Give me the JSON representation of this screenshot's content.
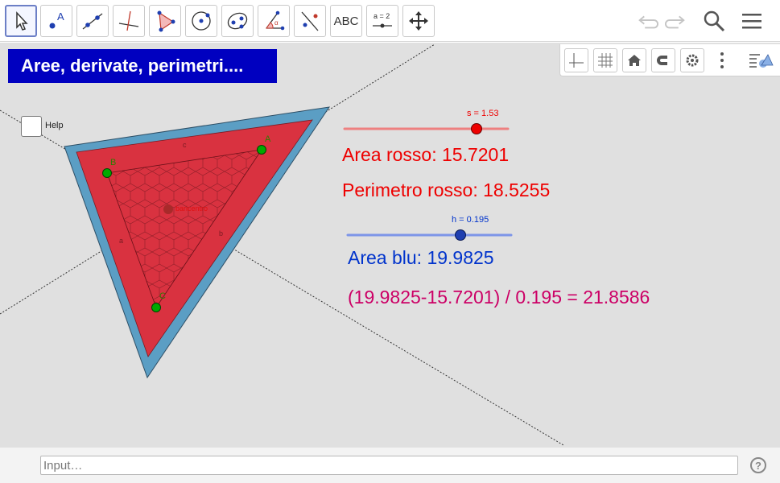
{
  "toolbar": {
    "tools": [
      {
        "name": "move-tool",
        "icon": "arrow-cursor-icon",
        "selected": true
      },
      {
        "name": "point-tool",
        "icon": "point-icon",
        "label": "A"
      },
      {
        "name": "line-tool",
        "icon": "line-through-points-icon"
      },
      {
        "name": "perpendicular-tool",
        "icon": "perpendicular-line-icon"
      },
      {
        "name": "polygon-tool",
        "icon": "polygon-icon"
      },
      {
        "name": "circle-tool",
        "icon": "circle-center-point-icon"
      },
      {
        "name": "conic-tool",
        "icon": "ellipse-icon"
      },
      {
        "name": "angle-tool",
        "icon": "angle-icon",
        "label": "α"
      },
      {
        "name": "reflect-tool",
        "icon": "reflect-about-line-icon"
      },
      {
        "name": "text-tool",
        "icon": "text-icon",
        "label": "ABC"
      },
      {
        "name": "slider-tool",
        "icon": "slider-icon",
        "label": "a = 2"
      },
      {
        "name": "move-graphics-tool",
        "icon": "move-arrows-icon"
      }
    ],
    "right": [
      "undo-icon",
      "redo-icon",
      "search-icon",
      "menu-icon"
    ]
  },
  "style_bar": [
    "axes-icon",
    "grid-icon",
    "home-icon",
    "point-capturing-icon",
    "settings-icon",
    "more-icon",
    "toggle-style-bar-icon"
  ],
  "title": "Aree,  derivate,  perimetri....",
  "help_checkbox": {
    "label": "Help",
    "checked": false
  },
  "slider_s": {
    "label": "s = 1.53",
    "value": 1.53,
    "color": "#ee0000"
  },
  "slider_h": {
    "label": "h = 0.195",
    "value": 0.195,
    "color": "#0033cc"
  },
  "texts": {
    "area_rosso": "Area rosso: 15.7201",
    "perimetro_rosso": "Perimetro rosso: 18.5255",
    "area_blu": "Area blu: 19.9825",
    "formula": "(19.9825-15.7201) / 0.195 = 21.8586"
  },
  "points": {
    "A": "A",
    "B": "B",
    "C": "C"
  },
  "segments": {
    "a": "a",
    "b": "b",
    "c": "c"
  },
  "colors": {
    "red_fill": "#d93240",
    "blue_fill": "#5b9ec4",
    "point": "#00aa00",
    "title_bg": "#0000c0"
  },
  "input": {
    "placeholder": "Input…"
  }
}
